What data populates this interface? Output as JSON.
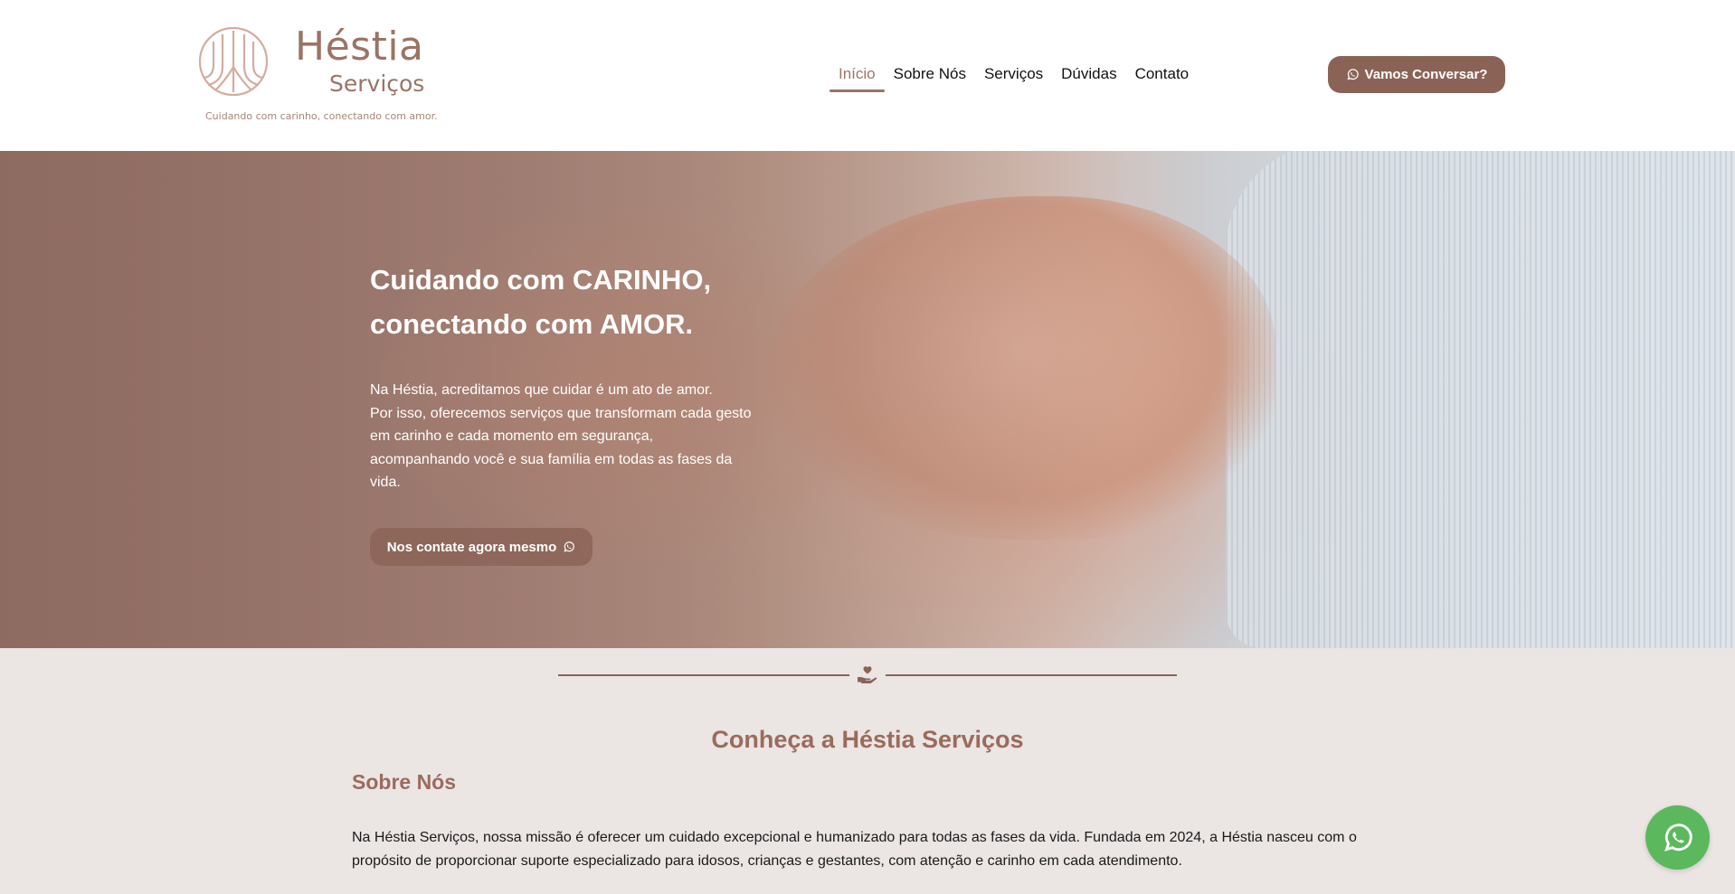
{
  "brand": {
    "name": "Héstia",
    "subname": "Serviços",
    "tagline": "Cuidando com carinho, conectando com amor."
  },
  "nav": {
    "items": [
      {
        "label": "Início",
        "active": true
      },
      {
        "label": "Sobre Nós"
      },
      {
        "label": "Serviços"
      },
      {
        "label": "Dúvidas"
      },
      {
        "label": "Contato"
      }
    ],
    "cta_label": "Vamos Conversar?"
  },
  "hero": {
    "title_line1": "Cuidando com CARINHO,",
    "title_line2": "conectando com AMOR.",
    "text_lines": [
      "Na Héstia, acreditamos que cuidar é um ato de amor.",
      "Por isso, oferecemos serviços que transformam cada gesto",
      "em carinho e cada momento em segurança,",
      "acompanhando você e sua família em todas as fases da",
      "vida."
    ],
    "cta_label": "Nos contate agora mesmo"
  },
  "about": {
    "section_title": "Conheça a Héstia Serviços",
    "subtitle": "Sobre Nós",
    "paragraph": "Na Héstia Serviços, nossa missão é oferecer um cuidado excepcional e humanizado para todas as fases da vida. Fundada em 2024, a Héstia nasceu com o propósito de proporcionar suporte especializado para idosos, crianças e gestantes, com atenção e carinho em cada atendimento."
  },
  "icons": {
    "logo": "hestia-logo-icon",
    "whatsapp": "whatsapp-icon",
    "divider": "hand-heart-icon"
  },
  "colors": {
    "brand": "#9b7364",
    "button": "#8b6356",
    "section_bg": "#ebe5e4",
    "whatsapp": "#5bb85d"
  }
}
